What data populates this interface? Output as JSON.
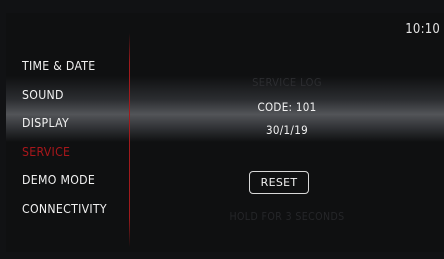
{
  "status_bar": {
    "time": "10:10"
  },
  "menu": {
    "items": [
      {
        "label": "TIME & DATE",
        "active": false
      },
      {
        "label": "SOUND",
        "active": false
      },
      {
        "label": "DISPLAY",
        "active": false
      },
      {
        "label": "SERVICE",
        "active": true
      },
      {
        "label": "DEMO MODE",
        "active": false
      },
      {
        "label": "CONNECTIVITY",
        "active": false
      }
    ]
  },
  "service": {
    "title": "SERVICE LOG",
    "code": "CODE: 101",
    "date": "30/1/19",
    "reset_label": "RESET",
    "hint": "HOLD FOR 3 SECONDS"
  },
  "colors": {
    "accent": "#a8171b",
    "text": "#f1f1f1",
    "background": "#0f1011"
  }
}
